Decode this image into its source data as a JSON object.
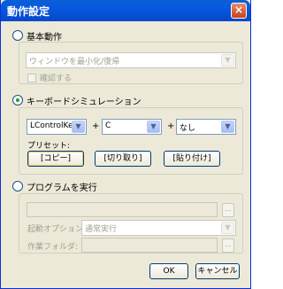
{
  "window": {
    "title": "動作設定",
    "close_glyph": "×"
  },
  "basic": {
    "radio_label": "基本動作",
    "action_combo": "ウィンドウを最小化/復帰",
    "confirm_label": "確認する"
  },
  "keyboard": {
    "radio_label": "キーボードシミュレーション",
    "key1": "LControlKey",
    "plus1": "+",
    "key2": "C",
    "plus2": "+",
    "key3": "なし",
    "preset_label": "プリセット:",
    "preset_copy": "[コピー]",
    "preset_cut": "[切り取り]",
    "preset_paste": "[貼り付け]"
  },
  "program": {
    "radio_label": "プログラムを実行",
    "path_value": "",
    "browse1": "...",
    "launch_label": "起動オプション:",
    "launch_value": "通常実行",
    "workdir_label": "作業フォルダ:",
    "workdir_value": "",
    "browse2": "..."
  },
  "footer": {
    "ok": "OK",
    "cancel": "キャンセル"
  },
  "icons": {
    "dropdown": "▼"
  }
}
